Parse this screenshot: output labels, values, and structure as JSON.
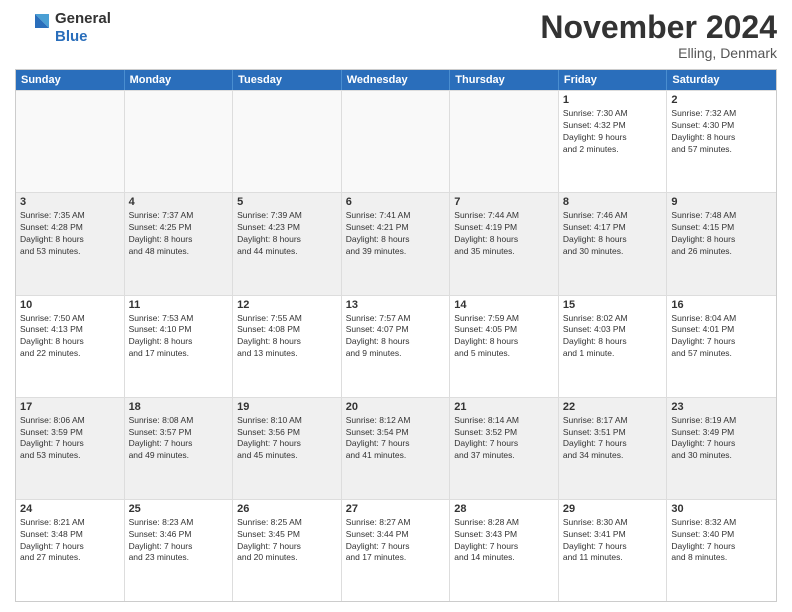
{
  "logo": {
    "general": "General",
    "blue": "Blue"
  },
  "header": {
    "title": "November 2024",
    "location": "Elling, Denmark"
  },
  "days_of_week": [
    "Sunday",
    "Monday",
    "Tuesday",
    "Wednesday",
    "Thursday",
    "Friday",
    "Saturday"
  ],
  "weeks": [
    [
      {
        "day": "",
        "info": "",
        "empty": true
      },
      {
        "day": "",
        "info": "",
        "empty": true
      },
      {
        "day": "",
        "info": "",
        "empty": true
      },
      {
        "day": "",
        "info": "",
        "empty": true
      },
      {
        "day": "",
        "info": "",
        "empty": true
      },
      {
        "day": "1",
        "info": "Sunrise: 7:30 AM\nSunset: 4:32 PM\nDaylight: 9 hours\nand 2 minutes.",
        "empty": false
      },
      {
        "day": "2",
        "info": "Sunrise: 7:32 AM\nSunset: 4:30 PM\nDaylight: 8 hours\nand 57 minutes.",
        "empty": false
      }
    ],
    [
      {
        "day": "3",
        "info": "Sunrise: 7:35 AM\nSunset: 4:28 PM\nDaylight: 8 hours\nand 53 minutes.",
        "empty": false
      },
      {
        "day": "4",
        "info": "Sunrise: 7:37 AM\nSunset: 4:25 PM\nDaylight: 8 hours\nand 48 minutes.",
        "empty": false
      },
      {
        "day": "5",
        "info": "Sunrise: 7:39 AM\nSunset: 4:23 PM\nDaylight: 8 hours\nand 44 minutes.",
        "empty": false
      },
      {
        "day": "6",
        "info": "Sunrise: 7:41 AM\nSunset: 4:21 PM\nDaylight: 8 hours\nand 39 minutes.",
        "empty": false
      },
      {
        "day": "7",
        "info": "Sunrise: 7:44 AM\nSunset: 4:19 PM\nDaylight: 8 hours\nand 35 minutes.",
        "empty": false
      },
      {
        "day": "8",
        "info": "Sunrise: 7:46 AM\nSunset: 4:17 PM\nDaylight: 8 hours\nand 30 minutes.",
        "empty": false
      },
      {
        "day": "9",
        "info": "Sunrise: 7:48 AM\nSunset: 4:15 PM\nDaylight: 8 hours\nand 26 minutes.",
        "empty": false
      }
    ],
    [
      {
        "day": "10",
        "info": "Sunrise: 7:50 AM\nSunset: 4:13 PM\nDaylight: 8 hours\nand 22 minutes.",
        "empty": false
      },
      {
        "day": "11",
        "info": "Sunrise: 7:53 AM\nSunset: 4:10 PM\nDaylight: 8 hours\nand 17 minutes.",
        "empty": false
      },
      {
        "day": "12",
        "info": "Sunrise: 7:55 AM\nSunset: 4:08 PM\nDaylight: 8 hours\nand 13 minutes.",
        "empty": false
      },
      {
        "day": "13",
        "info": "Sunrise: 7:57 AM\nSunset: 4:07 PM\nDaylight: 8 hours\nand 9 minutes.",
        "empty": false
      },
      {
        "day": "14",
        "info": "Sunrise: 7:59 AM\nSunset: 4:05 PM\nDaylight: 8 hours\nand 5 minutes.",
        "empty": false
      },
      {
        "day": "15",
        "info": "Sunrise: 8:02 AM\nSunset: 4:03 PM\nDaylight: 8 hours\nand 1 minute.",
        "empty": false
      },
      {
        "day": "16",
        "info": "Sunrise: 8:04 AM\nSunset: 4:01 PM\nDaylight: 7 hours\nand 57 minutes.",
        "empty": false
      }
    ],
    [
      {
        "day": "17",
        "info": "Sunrise: 8:06 AM\nSunset: 3:59 PM\nDaylight: 7 hours\nand 53 minutes.",
        "empty": false
      },
      {
        "day": "18",
        "info": "Sunrise: 8:08 AM\nSunset: 3:57 PM\nDaylight: 7 hours\nand 49 minutes.",
        "empty": false
      },
      {
        "day": "19",
        "info": "Sunrise: 8:10 AM\nSunset: 3:56 PM\nDaylight: 7 hours\nand 45 minutes.",
        "empty": false
      },
      {
        "day": "20",
        "info": "Sunrise: 8:12 AM\nSunset: 3:54 PM\nDaylight: 7 hours\nand 41 minutes.",
        "empty": false
      },
      {
        "day": "21",
        "info": "Sunrise: 8:14 AM\nSunset: 3:52 PM\nDaylight: 7 hours\nand 37 minutes.",
        "empty": false
      },
      {
        "day": "22",
        "info": "Sunrise: 8:17 AM\nSunset: 3:51 PM\nDaylight: 7 hours\nand 34 minutes.",
        "empty": false
      },
      {
        "day": "23",
        "info": "Sunrise: 8:19 AM\nSunset: 3:49 PM\nDaylight: 7 hours\nand 30 minutes.",
        "empty": false
      }
    ],
    [
      {
        "day": "24",
        "info": "Sunrise: 8:21 AM\nSunset: 3:48 PM\nDaylight: 7 hours\nand 27 minutes.",
        "empty": false
      },
      {
        "day": "25",
        "info": "Sunrise: 8:23 AM\nSunset: 3:46 PM\nDaylight: 7 hours\nand 23 minutes.",
        "empty": false
      },
      {
        "day": "26",
        "info": "Sunrise: 8:25 AM\nSunset: 3:45 PM\nDaylight: 7 hours\nand 20 minutes.",
        "empty": false
      },
      {
        "day": "27",
        "info": "Sunrise: 8:27 AM\nSunset: 3:44 PM\nDaylight: 7 hours\nand 17 minutes.",
        "empty": false
      },
      {
        "day": "28",
        "info": "Sunrise: 8:28 AM\nSunset: 3:43 PM\nDaylight: 7 hours\nand 14 minutes.",
        "empty": false
      },
      {
        "day": "29",
        "info": "Sunrise: 8:30 AM\nSunset: 3:41 PM\nDaylight: 7 hours\nand 11 minutes.",
        "empty": false
      },
      {
        "day": "30",
        "info": "Sunrise: 8:32 AM\nSunset: 3:40 PM\nDaylight: 7 hours\nand 8 minutes.",
        "empty": false
      }
    ]
  ]
}
